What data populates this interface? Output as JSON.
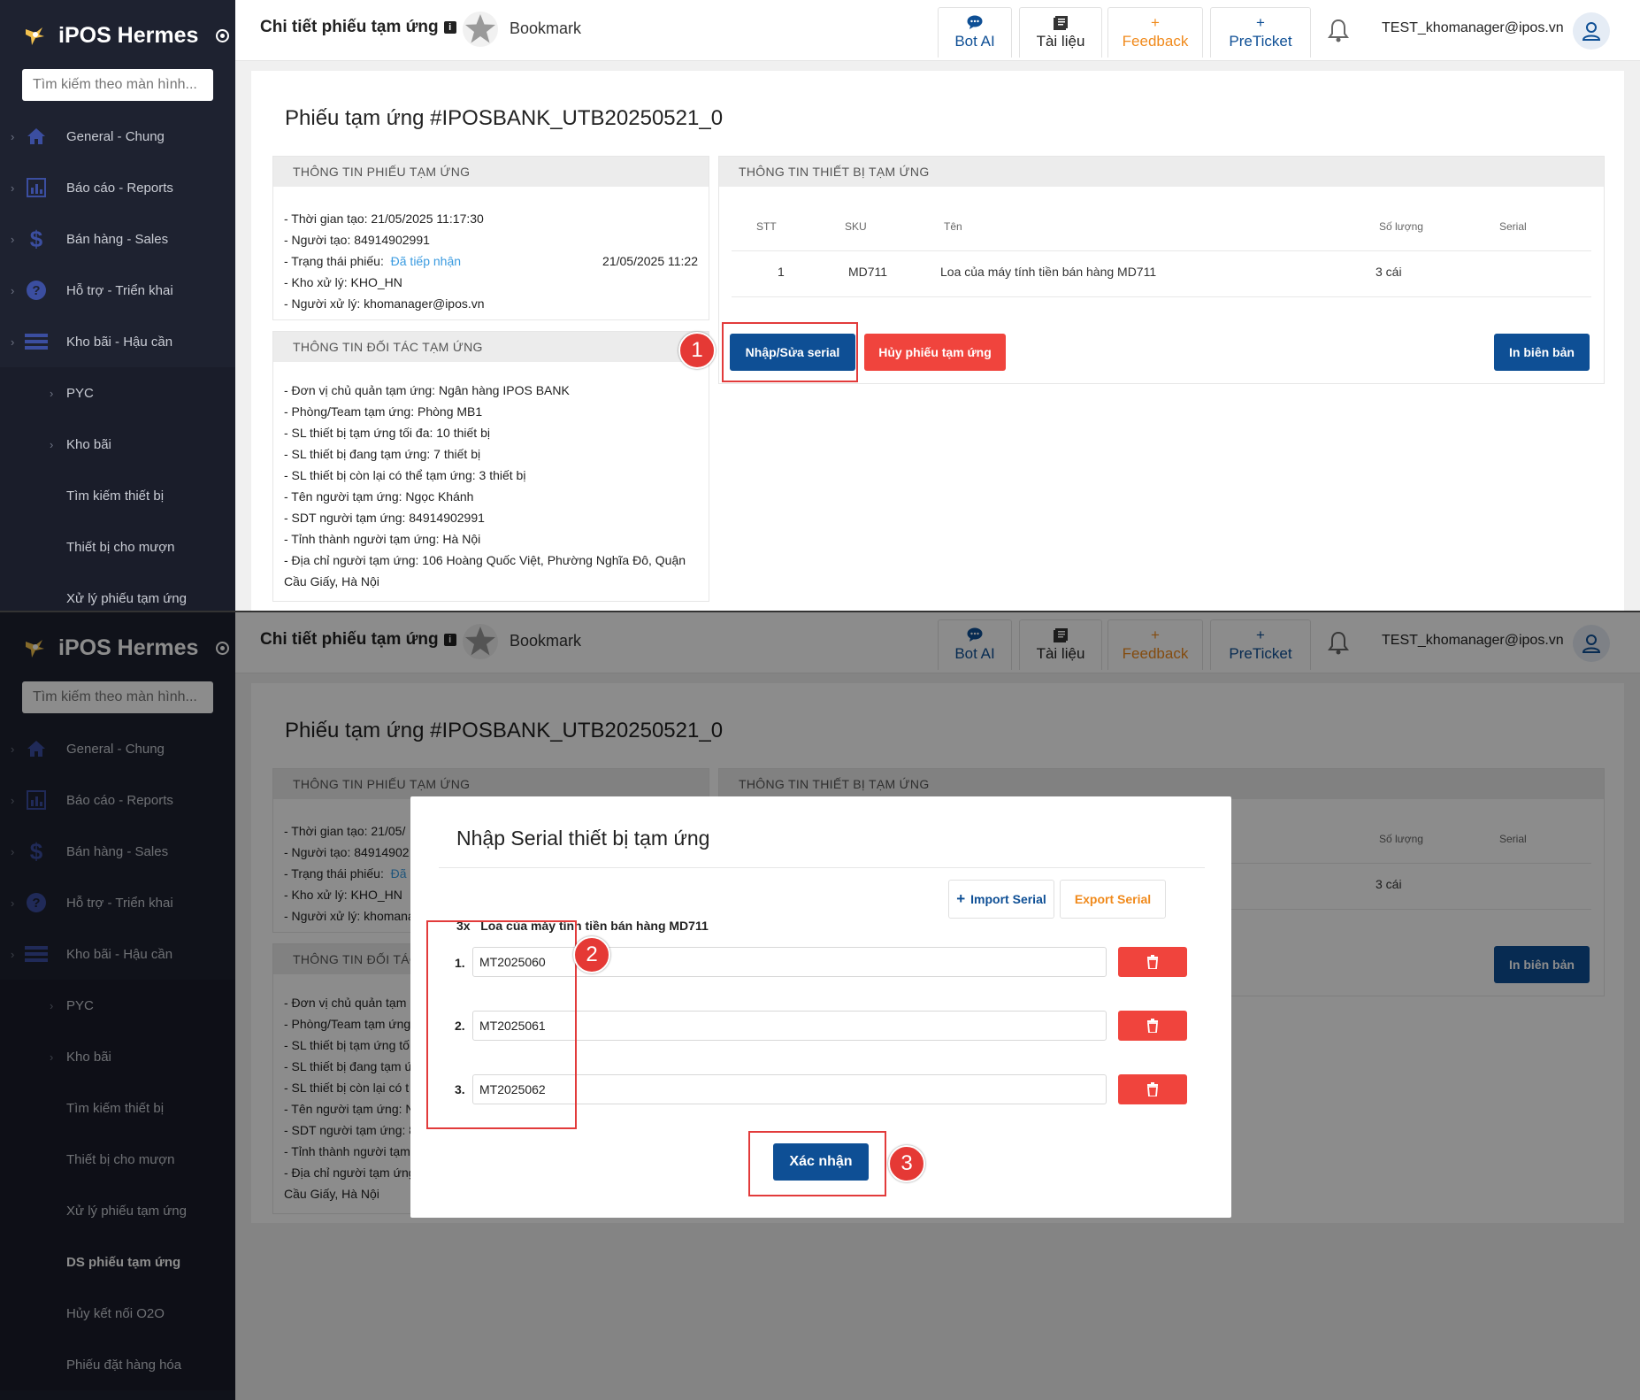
{
  "app": {
    "name": "iPOS Hermes",
    "search_placeholder": "Tìm kiếm theo màn hình...",
    "menu": [
      {
        "label": "General - Chung",
        "icon": "home-icon"
      },
      {
        "label": "Báo cáo - Reports",
        "icon": "report-icon"
      },
      {
        "label": "Bán hàng - Sales",
        "icon": "dollar-icon"
      },
      {
        "label": "Hỗ trợ - Triển khai",
        "icon": "help-icon"
      },
      {
        "label": "Kho bãi - Hậu cần",
        "icon": "warehouse-icon"
      }
    ],
    "submenu": [
      "PYC",
      "Kho bãi",
      "Tìm kiếm thiết bị",
      "Thiết bị cho mượn",
      "Xử lý phiếu tạm ứng",
      "DS phiếu tạm ứng",
      "Hủy kết nối O2O",
      "Phiếu đặt hàng hóa"
    ]
  },
  "header": {
    "title": "Chi tiết phiếu tạm ứng",
    "info_glyph": "i",
    "bookmark": "Bookmark",
    "bot_ai": "Bot AI",
    "docs": "Tài liệu",
    "feedback_plus": "+",
    "feedback": "Feedback",
    "preticket_plus": "+",
    "preticket": "PreTicket",
    "user": "TEST_khomanager@ipos.vn"
  },
  "page": {
    "title": "Phiếu tạm ứng #IPOSBANK_UTB20250521_0",
    "info_panel": {
      "header": "THÔNG TIN PHIẾU TẠM ỨNG",
      "created": "- Thời gian tạo: 21/05/2025 11:17:30",
      "creator": "- Người tạo: 84914902991",
      "status_label": "- Trạng thái phiếu:",
      "status_value": "Đã tiếp nhận",
      "status_time": "21/05/2025 11:22",
      "warehouse": "- Kho xử lý: KHO_HN",
      "handler": "- Người xử lý: khomanager@ipos.vn"
    },
    "partner_panel": {
      "header": "THÔNG TIN ĐỐI TÁC TẠM ỨNG",
      "lines": [
        "- Đơn vị chủ quản tạm ứng: Ngân hàng IPOS BANK",
        "- Phòng/Team tạm ứng: Phòng MB1",
        "- SL thiết bị tạm ứng tối đa: 10 thiết bị",
        "- SL thiết bị đang tạm ứng: 7 thiết bị",
        "- SL thiết bị còn lại có thể tạm ứng: 3 thiết bị",
        "- Tên người tạm ứng: Ngọc Khánh",
        "- SDT người tạm ứng: 84914902991",
        "- Tỉnh thành người tạm ứng: Hà Nội",
        "- Địa chỉ người tạm ứng: 106 Hoàng Quốc Việt, Phường Nghĩa Đô, Quận",
        "Cầu Giấy, Hà Nội"
      ],
      "lines_truncated": [
        "- Đơn vị chủ quản tạm",
        "- Phòng/Team tạm ứng",
        "- SL thiết bị tạm ứng tố",
        "- SL thiết bị đang tạm ứ",
        "- SL thiết bị còn lại có t",
        "- Tên người tạm ứng: N",
        "- SDT người tạm ứng: 8",
        "- Tỉnh thành người tạm",
        "- Địa chỉ người tạm ứng",
        "Cầu Giấy, Hà Nội"
      ]
    },
    "info_truncated": [
      "- Thời gian tạo: 21/05/",
      "- Người tạo: 84914902",
      "- Trạng thái phiếu:",
      "- Kho xử lý: KHO_HN",
      "- Người xử lý: khomana"
    ],
    "status_truncated": "Đã",
    "partner_header_truncated": "THÔNG TIN ĐỐI TÁC",
    "device_panel": {
      "header": "THÔNG TIN THIẾT BỊ TẠM ỨNG",
      "columns": [
        "STT",
        "SKU",
        "Tên",
        "Số lượng",
        "Serial"
      ],
      "rows": [
        {
          "stt": "1",
          "sku": "MD711",
          "name": "Loa của máy tính tiền bán hàng MD711",
          "qty": "3 cái",
          "serial": ""
        }
      ]
    },
    "buttons": {
      "edit_serial": "Nhập/Sửa serial",
      "cancel": "Hủy phiếu tạm ứng",
      "print": "In biên bản"
    }
  },
  "modal": {
    "title": "Nhập Serial thiết bị tạm ứng",
    "import": "Import Serial",
    "import_plus": "+",
    "export": "Export Serial",
    "group_qty": "3x",
    "group_name": "Loa của máy tính tiền bán hàng MD711",
    "serials": [
      {
        "index": "1.",
        "value": "MT2025060"
      },
      {
        "index": "2.",
        "value": "MT2025061"
      },
      {
        "index": "3.",
        "value": "MT2025062"
      }
    ],
    "confirm": "Xác nhận"
  },
  "steps": [
    "1",
    "2",
    "3"
  ],
  "colors": {
    "sidebar": "#1e2230",
    "primary": "#0e4f95",
    "danger": "#f0443d",
    "feedback": "#f08a1c",
    "link": "#3a9be0",
    "callout": "#e53935"
  }
}
